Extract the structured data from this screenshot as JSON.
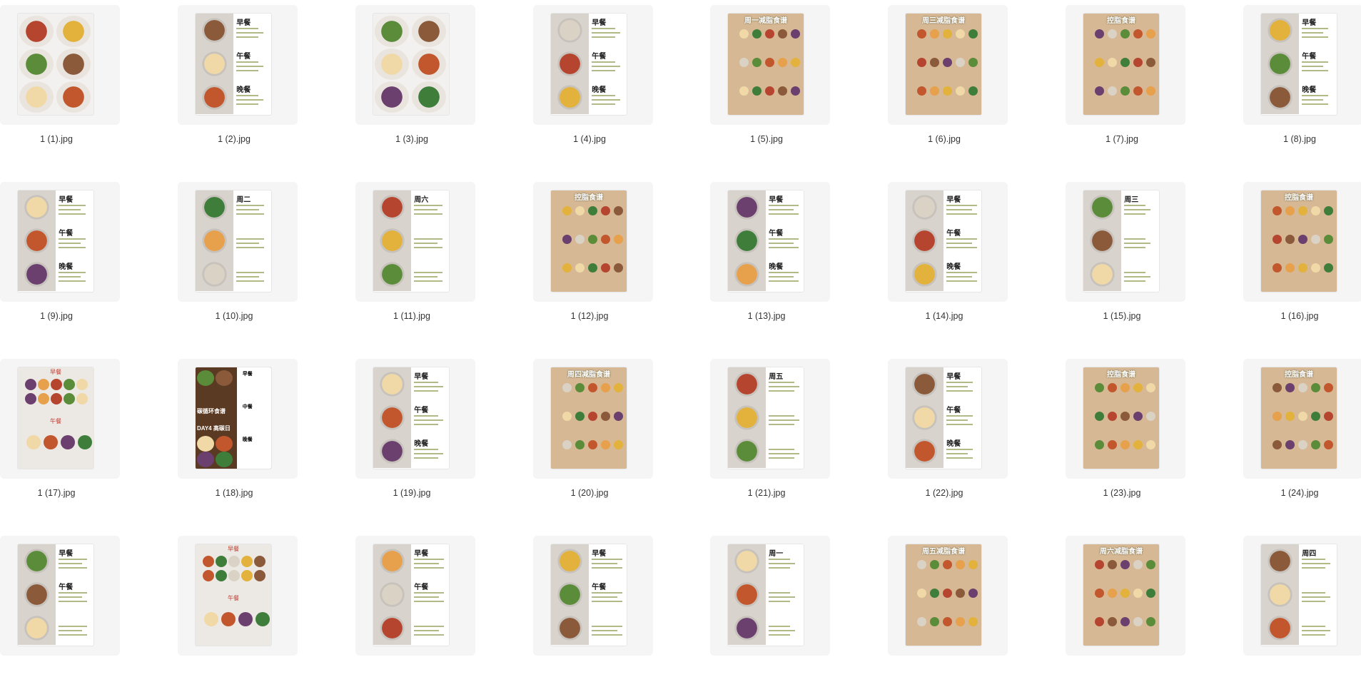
{
  "files": [
    {
      "name": "1 (1).jpg",
      "kind": "plates"
    },
    {
      "name": "1 (2).jpg",
      "kind": "meal",
      "text": [
        "早餐",
        "午餐",
        "晚餐"
      ]
    },
    {
      "name": "1 (3).jpg",
      "kind": "plates"
    },
    {
      "name": "1 (4).jpg",
      "kind": "meal",
      "text": [
        "早餐",
        "午餐",
        "晚餐"
      ]
    },
    {
      "name": "1 (5).jpg",
      "kind": "kraft",
      "title": "周一减脂食谱"
    },
    {
      "name": "1 (6).jpg",
      "kind": "kraft",
      "title": "周三减脂食谱"
    },
    {
      "name": "1 (7).jpg",
      "kind": "kraft",
      "title": "控脂食谱"
    },
    {
      "name": "1 (8).jpg",
      "kind": "meal",
      "text": [
        "早餐",
        "午餐",
        "晚餐"
      ]
    },
    {
      "name": "1 (9).jpg",
      "kind": "meal",
      "text": [
        "早餐",
        "午餐",
        "晚餐"
      ]
    },
    {
      "name": "1 (10).jpg",
      "kind": "meal",
      "text": [
        "周二",
        "",
        ""
      ]
    },
    {
      "name": "1 (11).jpg",
      "kind": "meal",
      "text": [
        "周六",
        "",
        ""
      ]
    },
    {
      "name": "1 (12).jpg",
      "kind": "kraft",
      "title": "控脂食谱"
    },
    {
      "name": "1 (13).jpg",
      "kind": "meal",
      "text": [
        "早餐",
        "午餐",
        "晚餐"
      ]
    },
    {
      "name": "1 (14).jpg",
      "kind": "meal",
      "text": [
        "早餐",
        "午餐",
        "晚餐"
      ]
    },
    {
      "name": "1 (15).jpg",
      "kind": "meal",
      "text": [
        "周三",
        "",
        ""
      ]
    },
    {
      "name": "1 (16).jpg",
      "kind": "kraft",
      "title": "控脂食谱"
    },
    {
      "name": "1 (17).jpg",
      "kind": "box",
      "text": [
        "早餐",
        "午餐"
      ]
    },
    {
      "name": "1 (18).jpg",
      "kind": "dark",
      "text": [
        "碳循环食谱",
        "DAY4 高碳日",
        "早餐",
        "中餐",
        "晚餐"
      ]
    },
    {
      "name": "1 (19).jpg",
      "kind": "meal",
      "text": [
        "早餐",
        "午餐",
        "晚餐"
      ]
    },
    {
      "name": "1 (20).jpg",
      "kind": "kraft",
      "title": "周四减脂食谱"
    },
    {
      "name": "1 (21).jpg",
      "kind": "meal",
      "text": [
        "周五",
        "",
        ""
      ]
    },
    {
      "name": "1 (22).jpg",
      "kind": "meal",
      "text": [
        "早餐",
        "午餐",
        "晚餐"
      ]
    },
    {
      "name": "1 (23).jpg",
      "kind": "kraft",
      "title": "控脂食谱"
    },
    {
      "name": "1 (24).jpg",
      "kind": "kraft",
      "title": "控脂食谱"
    },
    {
      "name": "",
      "kind": "meal",
      "text": [
        "早餐",
        "午餐",
        ""
      ]
    },
    {
      "name": "",
      "kind": "box",
      "text": [
        "早餐",
        "午餐"
      ]
    },
    {
      "name": "",
      "kind": "meal",
      "text": [
        "早餐",
        "午餐",
        ""
      ]
    },
    {
      "name": "",
      "kind": "meal",
      "text": [
        "早餐",
        "午餐",
        ""
      ]
    },
    {
      "name": "",
      "kind": "meal",
      "text": [
        "周一",
        "",
        ""
      ]
    },
    {
      "name": "",
      "kind": "kraft",
      "title": "周五减脂食谱"
    },
    {
      "name": "",
      "kind": "kraft",
      "title": "周六减脂食谱"
    },
    {
      "name": "",
      "kind": "meal",
      "text": [
        "周四",
        "",
        ""
      ]
    }
  ],
  "palette": {
    "foods": [
      "#b5452f",
      "#e3b23c",
      "#5b8c3a",
      "#8a5a3b",
      "#f0d9a7",
      "#c2572e",
      "#6b3f6e",
      "#3f7d3a",
      "#e7a04b",
      "#d9d2c5"
    ],
    "accent": "#7d8a36"
  }
}
